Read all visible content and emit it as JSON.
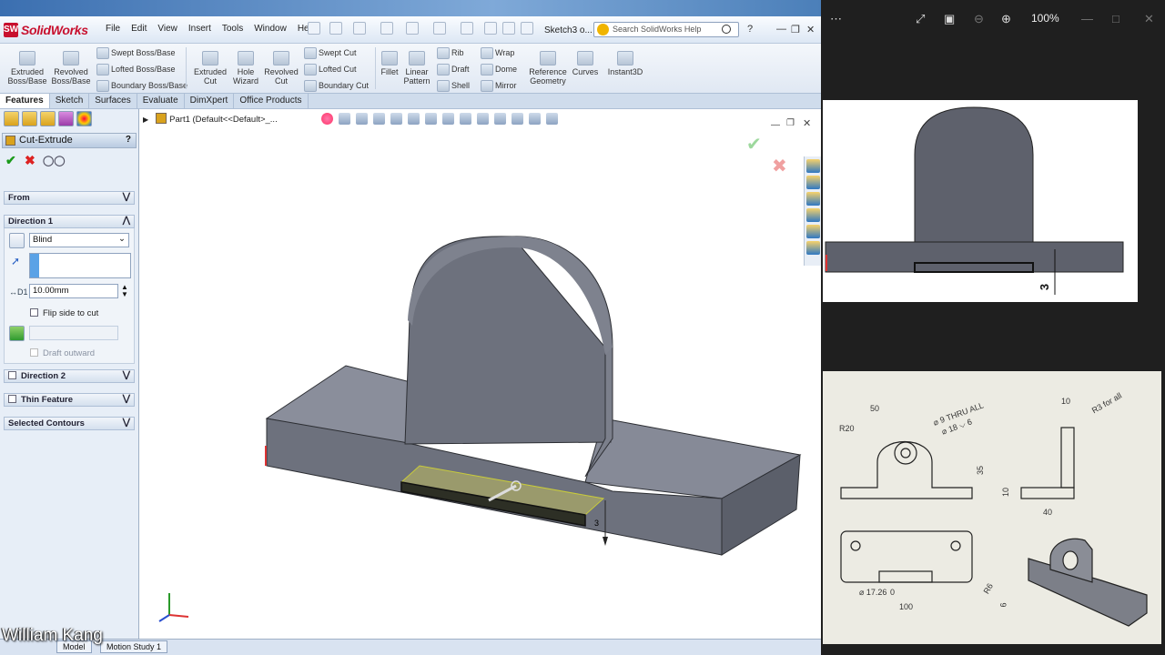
{
  "window": {
    "app_name": "SolidWorks",
    "doc_title": "Sketch3 o...",
    "search_placeholder": "Search SolidWorks Help"
  },
  "menu": [
    "File",
    "Edit",
    "View",
    "Insert",
    "Tools",
    "Window",
    "Help"
  ],
  "ribbon": {
    "big": [
      {
        "l1": "Extruded",
        "l2": "Boss/Base"
      },
      {
        "l1": "Revolved",
        "l2": "Boss/Base"
      },
      {
        "l1": "Extruded",
        "l2": "Cut"
      },
      {
        "l1": "Hole",
        "l2": "Wizard"
      },
      {
        "l1": "Revolved",
        "l2": "Cut"
      },
      {
        "l1": "Fillet",
        "l2": ""
      },
      {
        "l1": "Linear",
        "l2": "Pattern"
      },
      {
        "l1": "Reference",
        "l2": "Geometry"
      },
      {
        "l1": "Curves",
        "l2": ""
      },
      {
        "l1": "Instant3D",
        "l2": ""
      }
    ],
    "small": [
      "Swept Boss/Base",
      "Lofted Boss/Base",
      "Boundary Boss/Base",
      "Swept Cut",
      "Lofted Cut",
      "Boundary Cut",
      "Rib",
      "Draft",
      "Shell",
      "Wrap",
      "Dome",
      "Mirror"
    ]
  },
  "tabs": [
    "Features",
    "Sketch",
    "Surfaces",
    "Evaluate",
    "DimXpert",
    "Office Products"
  ],
  "property_manager": {
    "title": "Cut-Extrude",
    "help": "?",
    "from_label": "From",
    "direction1_label": "Direction 1",
    "end_condition": "Blind",
    "depth_value": "10.00mm",
    "flip_label": "Flip side to cut",
    "draft_label": "Draft outward",
    "direction2_label": "Direction 2",
    "thin_label": "Thin Feature",
    "contours_label": "Selected Contours"
  },
  "tree": {
    "part_label": "Part1  (Default<<Default>_..."
  },
  "preview_dim": "3",
  "bottom_tabs": [
    "Model",
    "Motion Study 1"
  ],
  "watermark": "William Kang",
  "viewer": {
    "zoom": "100%"
  },
  "reference_drawing": {
    "dims": [
      "50",
      "R20",
      "⌀ 9 THRU ALL",
      "⌀ 18 ⌵ 6",
      "35",
      "10",
      "R3 for all",
      "10",
      "40",
      "⌀ 17.26",
      "0",
      "100",
      "R6",
      "6"
    ]
  },
  "colors": {
    "model_grey": "#6d717d",
    "accent_red": "#c8102e",
    "ribbon_blue": "#d9e3f1"
  }
}
